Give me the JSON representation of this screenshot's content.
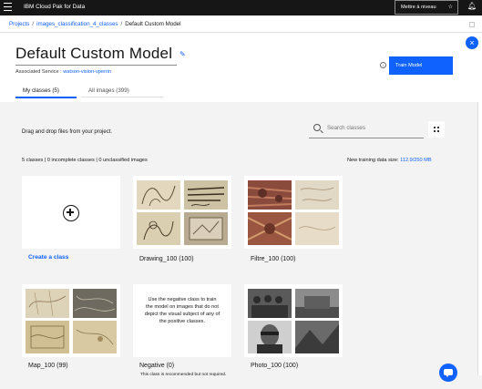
{
  "topbar": {
    "brand": "IBM Cloud Pak for Data",
    "upgrade_label": "Mettre à niveau"
  },
  "breadcrumb": {
    "items": [
      "Projects",
      "images_classification_4_classes",
      "Default Custom Model"
    ]
  },
  "header": {
    "title": "Default Custom Model",
    "associated_label": "Associated Service :",
    "associated_service": "watson-vision-vperrin",
    "train_button": "Train Model",
    "tabs": [
      {
        "label": "My classes (5)",
        "selected": true
      },
      {
        "label": "All images (399)",
        "selected": false
      }
    ]
  },
  "toolbar": {
    "drag_text": "Drag and drop files from your project.",
    "search_placeholder": "Search classes"
  },
  "summary": {
    "text": "5 classes | 0 incomplete classes | 0 unclassified images",
    "datasize_label": "New training data size:",
    "datasize_value": "112.9/250 MB"
  },
  "create_class": {
    "label": "Create a class"
  },
  "classes": [
    {
      "name": "Drawing_100 (100)"
    },
    {
      "name": "Filtre_100 (100)"
    },
    {
      "name": "Map_100 (99)"
    },
    {
      "name": "Negative (0)",
      "description": "Use the negative class to train the model on images that do not depict the visual subject of any of the positive classes.",
      "note": "This class is recommended but not required."
    },
    {
      "name": "Photo_100 (100)"
    }
  ],
  "colors": {
    "accent": "#0f62fe",
    "topbar": "#161616",
    "background": "#f3f3f3"
  }
}
